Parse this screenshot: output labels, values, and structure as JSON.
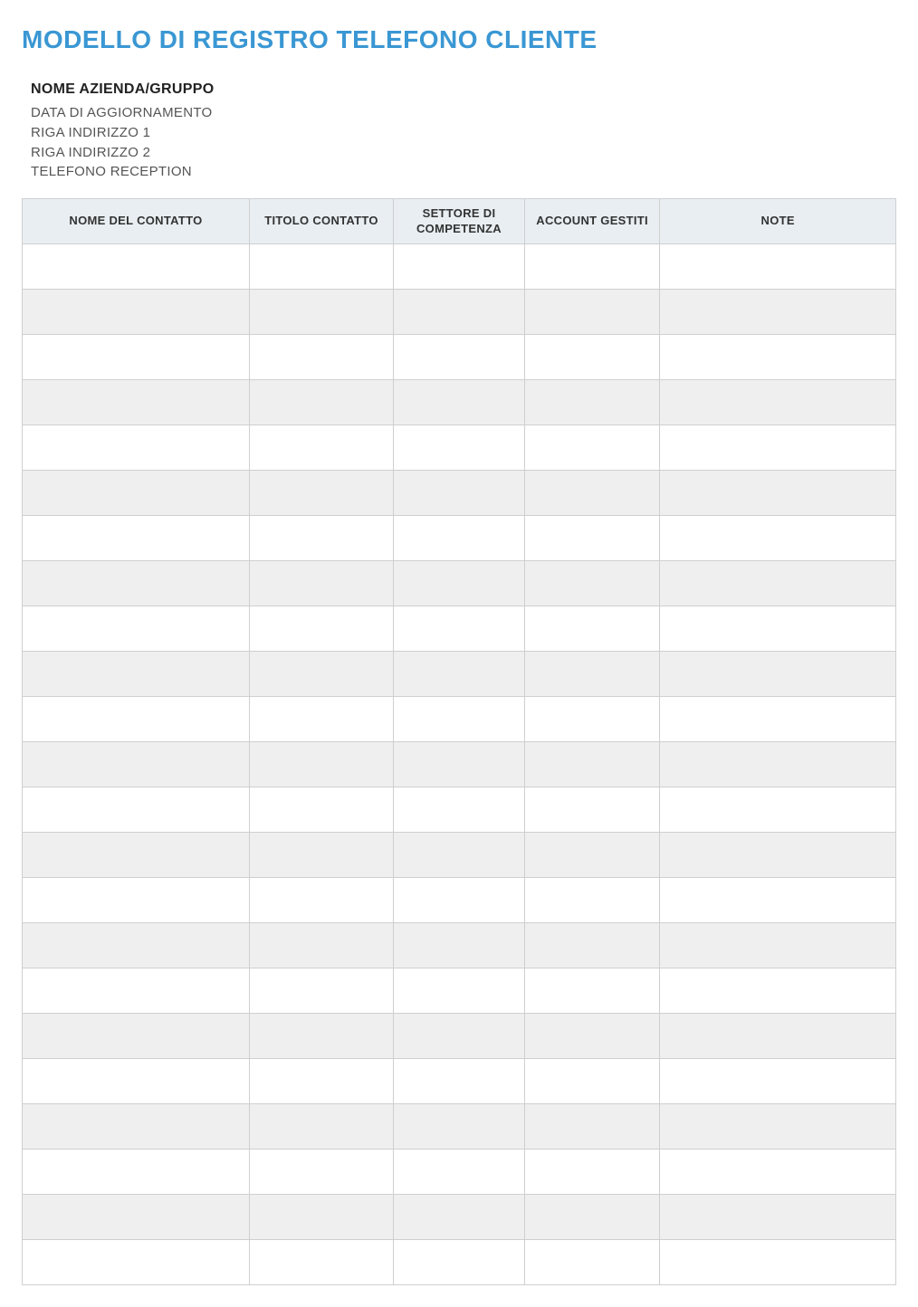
{
  "header": {
    "title": "MODELLO DI REGISTRO TELEFONO CLIENTE"
  },
  "info": {
    "company_label": "NOME AZIENDA/GRUPPO",
    "lines": [
      "DATA DI AGGIORNAMENTO",
      "RIGA INDIRIZZO 1",
      "RIGA INDIRIZZO 2",
      "TELEFONO RECEPTION"
    ]
  },
  "table": {
    "headers": {
      "contact_name": "NOME DEL CONTATTO",
      "contact_title": "TITOLO CONTATTO",
      "sector": "SETTORE DI COMPETENZA",
      "accounts_managed": "ACCOUNT GESTITI",
      "notes": "NOTE"
    },
    "rows": [
      {
        "contact_name": "",
        "contact_title": "",
        "sector": "",
        "accounts_managed": "",
        "notes": ""
      },
      {
        "contact_name": "",
        "contact_title": "",
        "sector": "",
        "accounts_managed": "",
        "notes": ""
      },
      {
        "contact_name": "",
        "contact_title": "",
        "sector": "",
        "accounts_managed": "",
        "notes": ""
      },
      {
        "contact_name": "",
        "contact_title": "",
        "sector": "",
        "accounts_managed": "",
        "notes": ""
      },
      {
        "contact_name": "",
        "contact_title": "",
        "sector": "",
        "accounts_managed": "",
        "notes": ""
      },
      {
        "contact_name": "",
        "contact_title": "",
        "sector": "",
        "accounts_managed": "",
        "notes": ""
      },
      {
        "contact_name": "",
        "contact_title": "",
        "sector": "",
        "accounts_managed": "",
        "notes": ""
      },
      {
        "contact_name": "",
        "contact_title": "",
        "sector": "",
        "accounts_managed": "",
        "notes": ""
      },
      {
        "contact_name": "",
        "contact_title": "",
        "sector": "",
        "accounts_managed": "",
        "notes": ""
      },
      {
        "contact_name": "",
        "contact_title": "",
        "sector": "",
        "accounts_managed": "",
        "notes": ""
      },
      {
        "contact_name": "",
        "contact_title": "",
        "sector": "",
        "accounts_managed": "",
        "notes": ""
      },
      {
        "contact_name": "",
        "contact_title": "",
        "sector": "",
        "accounts_managed": "",
        "notes": ""
      },
      {
        "contact_name": "",
        "contact_title": "",
        "sector": "",
        "accounts_managed": "",
        "notes": ""
      },
      {
        "contact_name": "",
        "contact_title": "",
        "sector": "",
        "accounts_managed": "",
        "notes": ""
      },
      {
        "contact_name": "",
        "contact_title": "",
        "sector": "",
        "accounts_managed": "",
        "notes": ""
      },
      {
        "contact_name": "",
        "contact_title": "",
        "sector": "",
        "accounts_managed": "",
        "notes": ""
      },
      {
        "contact_name": "",
        "contact_title": "",
        "sector": "",
        "accounts_managed": "",
        "notes": ""
      },
      {
        "contact_name": "",
        "contact_title": "",
        "sector": "",
        "accounts_managed": "",
        "notes": ""
      },
      {
        "contact_name": "",
        "contact_title": "",
        "sector": "",
        "accounts_managed": "",
        "notes": ""
      },
      {
        "contact_name": "",
        "contact_title": "",
        "sector": "",
        "accounts_managed": "",
        "notes": ""
      },
      {
        "contact_name": "",
        "contact_title": "",
        "sector": "",
        "accounts_managed": "",
        "notes": ""
      },
      {
        "contact_name": "",
        "contact_title": "",
        "sector": "",
        "accounts_managed": "",
        "notes": ""
      },
      {
        "contact_name": "",
        "contact_title": "",
        "sector": "",
        "accounts_managed": "",
        "notes": ""
      }
    ]
  }
}
